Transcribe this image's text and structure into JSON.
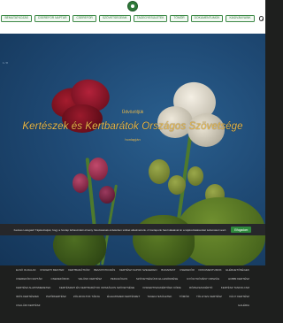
{
  "brand": {
    "primary": "#2f7a3a",
    "hero_text": "#e8b84a",
    "cookie_button": "#2f8a3e"
  },
  "nav": {
    "items": [
      "Bemutatkozás",
      "Cserefór Naptár",
      "Cserefór",
      "Szövetségeink",
      "Tagegyesületek",
      "Tömör",
      "Dokumentumok",
      "Kiadványaink"
    ],
    "search_icon": "search-icon"
  },
  "hero": {
    "tag": "1 / 8",
    "welcome": "Üdvözöljük",
    "title": "Kertészek és Kertbarátok Országos Szövetsége",
    "subtitle": "honlapján"
  },
  "cookie": {
    "text": "Kedves Látogató! Tájékoztatjuk, hogy a honlap felhasználói élmény fokozásának érdekében sütiket alkalmazunk. A honlapunk használatával ön a tájékoztatásunkat tudomásul veszi.",
    "accept_label": "Elfogadom"
  },
  "footer": {
    "links": [
      "Első oldalak",
      "Kiskerti Mester",
      "Kertbarátkör",
      "Bemutatkozás",
      "Kertész Napok Szegeden",
      "Budapest",
      "Cserefór",
      "Dokumentumok",
      "Elérhetőségek",
      "Cserefór Naptár",
      "Cserefórok",
      "Velünk Kertész",
      "Pedagógus",
      "Szövetségünk Ellenőrzése",
      "Gyógynövény Ország",
      "Hobbi Kertész",
      "Kertész Alapismeretek",
      "Kertészeti és Kertbarátok Országos Szövetsége",
      "Kiskertiszakértőek Köre",
      "Rózsaszakértő",
      "Kertész Tanfolyam",
      "Idős kertészek",
      "Papírkertész",
      "Zöldfoltok Tárja",
      "Élelmiszer kertészet",
      "Tagegyesületek",
      "Tömör",
      "Tölgyes Kertész",
      "Vályi Kertész",
      "Családi Kertész",
      "Galéria"
    ]
  }
}
